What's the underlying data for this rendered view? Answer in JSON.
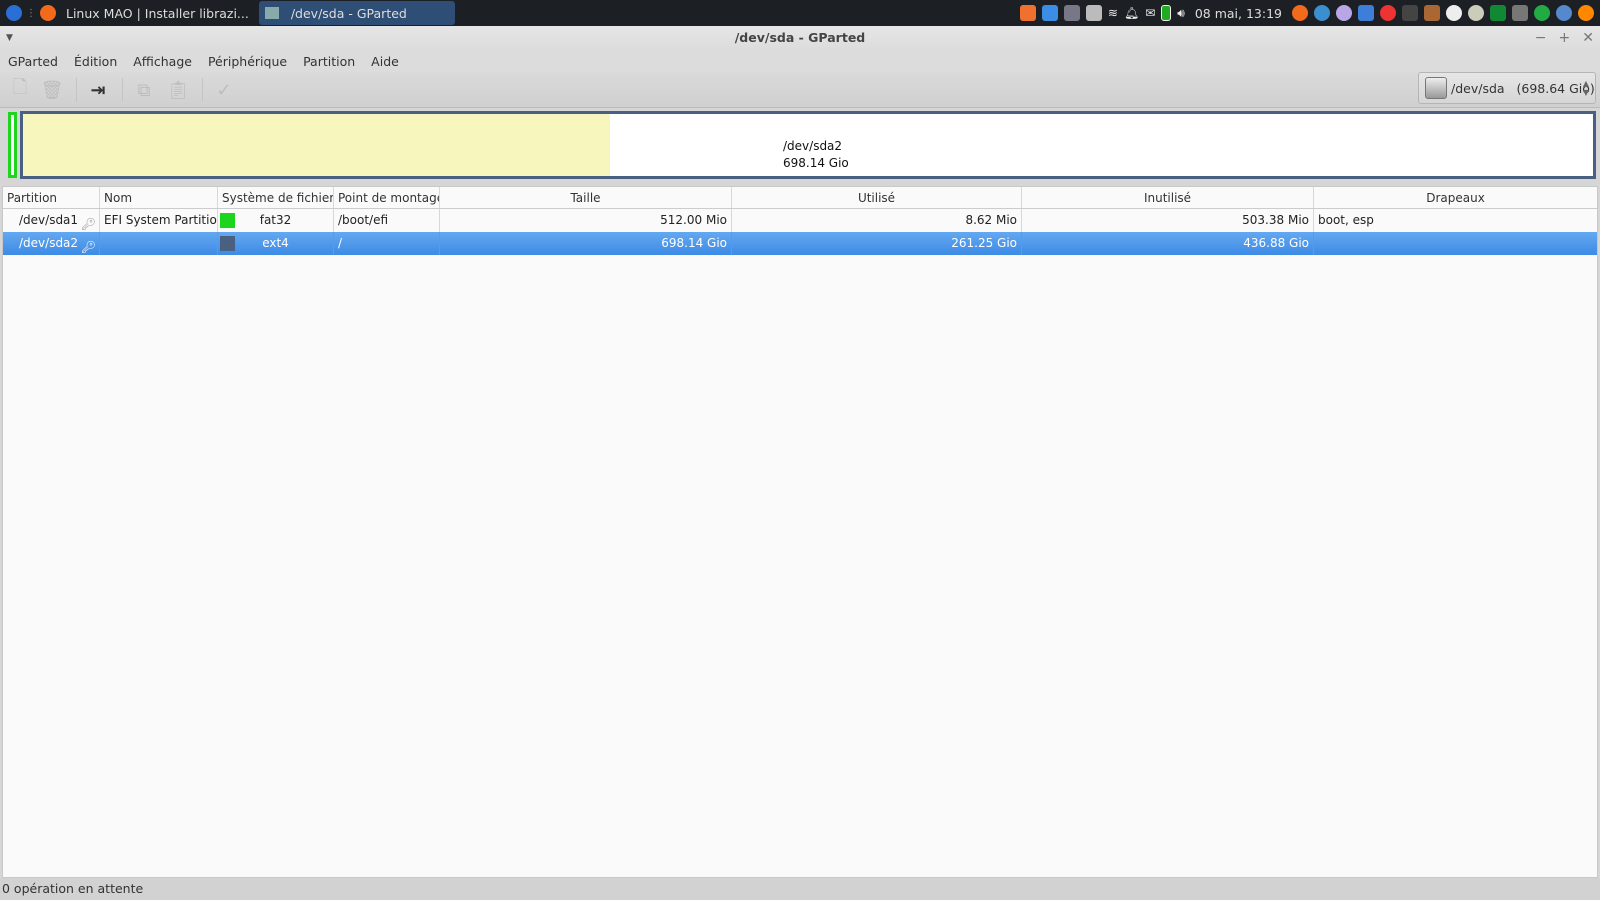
{
  "taskbar": {
    "tasks": [
      {
        "label": "Linux MAO | Installer librazi..."
      },
      {
        "label": "/dev/sda - GParted"
      }
    ],
    "clock": "08 mai, 13:19"
  },
  "window": {
    "title": "/dev/sda - GParted",
    "minimize": "−",
    "maximize": "+",
    "close": "✕"
  },
  "menu": [
    "GParted",
    "Édition",
    "Affichage",
    "Périphérique",
    "Partition",
    "Aide"
  ],
  "toolbar": {
    "new_icon": "new-partition-icon",
    "delete_icon": "delete-icon",
    "resize_icon": "resize-move-icon",
    "copy_icon": "copy-icon",
    "paste_icon": "paste-icon",
    "apply_icon": "apply-icon"
  },
  "device_selector": {
    "device": "/dev/sda",
    "size": "(698.64 Gio)"
  },
  "diskmap": {
    "selected_name": "/dev/sda2",
    "selected_size": "698.14 Gio",
    "used_fraction": 0.374,
    "colors": {
      "fat32": "#1ed51e",
      "ext4": "#4a6082",
      "used": "#f7f6bc"
    }
  },
  "table": {
    "headers": [
      "Partition",
      "Nom",
      "Système de fichiers",
      "Point de montage",
      "Taille",
      "Utilisé",
      "Inutilisé",
      "Drapeaux"
    ],
    "rows": [
      {
        "partition": "/dev/sda1",
        "name": "EFI System Partition",
        "fs": "fat32",
        "fs_color": "#1ed51e",
        "mount": "/boot/efi",
        "size": "512.00 Mio",
        "used": "8.62 Mio",
        "unused": "503.38 Mio",
        "flags": "boot, esp",
        "selected": false
      },
      {
        "partition": "/dev/sda2",
        "name": "",
        "fs": "ext4",
        "fs_color": "#4a6082",
        "mount": "/",
        "size": "698.14 Gio",
        "used": "261.25 Gio",
        "unused": "436.88 Gio",
        "flags": "",
        "selected": true
      }
    ]
  },
  "status": "0 opération en attente"
}
